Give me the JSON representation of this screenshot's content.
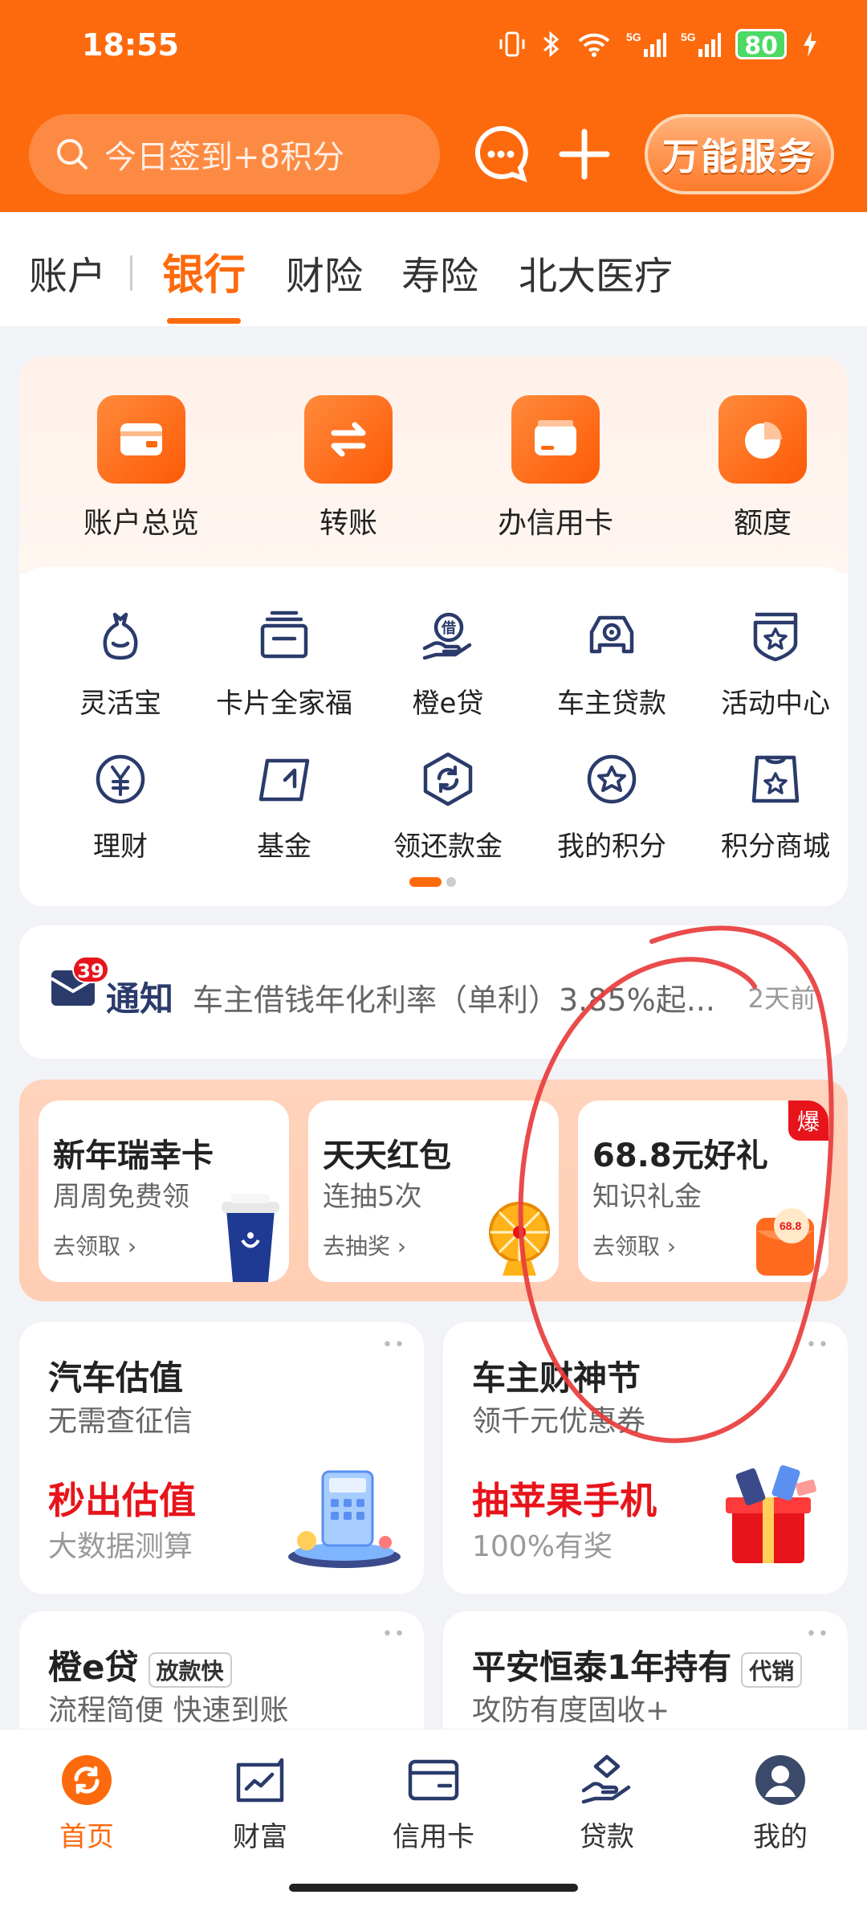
{
  "status": {
    "time": "18:55",
    "battery": "80",
    "network": "5G"
  },
  "header": {
    "search_placeholder": "今日签到+8积分",
    "service_button": "万能服务"
  },
  "tabs": [
    "账户",
    "银行",
    "财险",
    "寿险",
    "北大医疗"
  ],
  "main_actions": [
    "账户总览",
    "转账",
    "办信用卡",
    "额度"
  ],
  "services_row1": [
    "灵活宝",
    "卡片全家福",
    "橙e贷",
    "车主贷款",
    "活动中心"
  ],
  "services_row2": [
    "理财",
    "基金",
    "领还款金",
    "我的积分",
    "积分商城"
  ],
  "notice": {
    "badge": "39",
    "title": "通知",
    "text": "车主借钱年化利率（单利）3.85%起...",
    "time": "2天前"
  },
  "promos": [
    {
      "title": "新年瑞幸卡",
      "subtitle": "周周免费领",
      "link": "去领取"
    },
    {
      "title": "天天红包",
      "subtitle": "连抽5次",
      "link": "去抽奖"
    },
    {
      "title": "68.8元好礼",
      "subtitle": "知识礼金",
      "link": "去领取",
      "badge": "爆"
    }
  ],
  "features": [
    {
      "title": "汽车估值",
      "subtitle": "无需查征信",
      "highlight": "秒出估值",
      "highlight_sub": "大数据测算"
    },
    {
      "title": "车主财神节",
      "subtitle": "领千元优惠券",
      "highlight": "抽苹果手机",
      "highlight_sub": "100%有奖"
    },
    {
      "title": "橙e贷",
      "tag": "放款快",
      "subtitle": "流程简便 快速到账"
    },
    {
      "title": "平安恒泰1年持有",
      "tag": "代销",
      "subtitle": "攻防有度固收+"
    }
  ],
  "bottom_nav": [
    "首页",
    "财富",
    "信用卡",
    "贷款",
    "我的"
  ],
  "colors": {
    "brand": "#fd6a0d",
    "highlight": "#e8141b",
    "annotation": "#e83c3c"
  }
}
